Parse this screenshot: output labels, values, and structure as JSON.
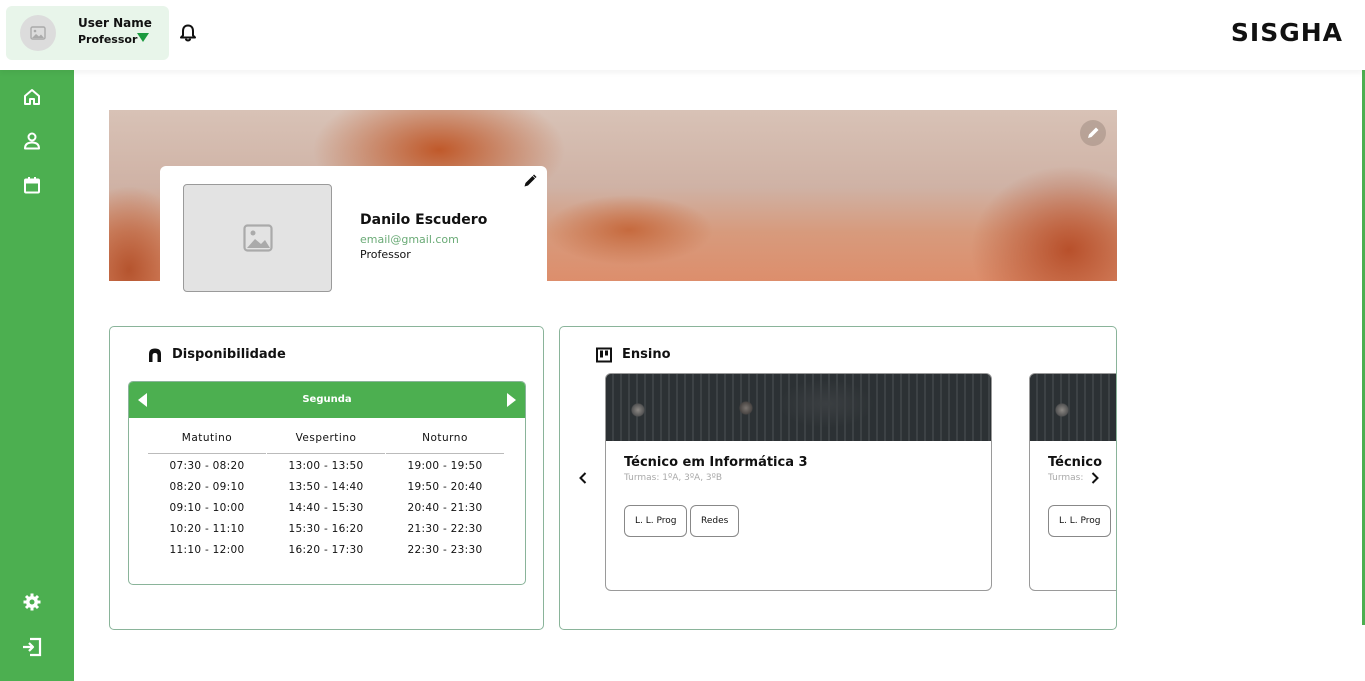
{
  "header": {
    "user_name": "User Name",
    "user_role": "Professor",
    "logo_text": "SISGHA"
  },
  "profile": {
    "name": "Danilo Escudero",
    "email": "email@gmail.com",
    "role": "Professor"
  },
  "availability": {
    "title": "Disponibilidade",
    "day": "Segunda",
    "columns": [
      {
        "label": "Matutino",
        "slots": [
          "07:30 - 08:20",
          "08:20 - 09:10",
          "09:10 - 10:00",
          "10:20 - 11:10",
          "11:10 - 12:00"
        ]
      },
      {
        "label": "Vespertino",
        "slots": [
          "13:00 - 13:50",
          "13:50 - 14:40",
          "14:40 - 15:30",
          "15:30 - 16:20",
          "16:20 - 17:30"
        ]
      },
      {
        "label": "Noturno",
        "slots": [
          "19:00 - 19:50",
          "19:50 - 20:40",
          "20:40 - 21:30",
          "21:30 - 22:30",
          "22:30 - 23:30"
        ]
      }
    ]
  },
  "teaching": {
    "title": "Ensino",
    "courses": [
      {
        "title": "Técnico em Informática 3",
        "classes": "Turmas: 1ºA, 3ºA, 3ºB",
        "tags": [
          "L. L. Prog",
          "Redes"
        ]
      },
      {
        "title": "Técnico",
        "classes": "Turmas:",
        "tags": [
          "L. L. Prog"
        ]
      }
    ]
  },
  "colors": {
    "brand_green": "#4caf50",
    "user_card_bg": "#e8f5ea",
    "email_green": "#6bab77"
  },
  "icons": {
    "sidebar": [
      "home-icon",
      "user-icon",
      "calendar-icon",
      "gear-icon",
      "logout-icon"
    ],
    "header": [
      "image-placeholder-icon",
      "caret-down-icon",
      "bell-icon"
    ]
  }
}
